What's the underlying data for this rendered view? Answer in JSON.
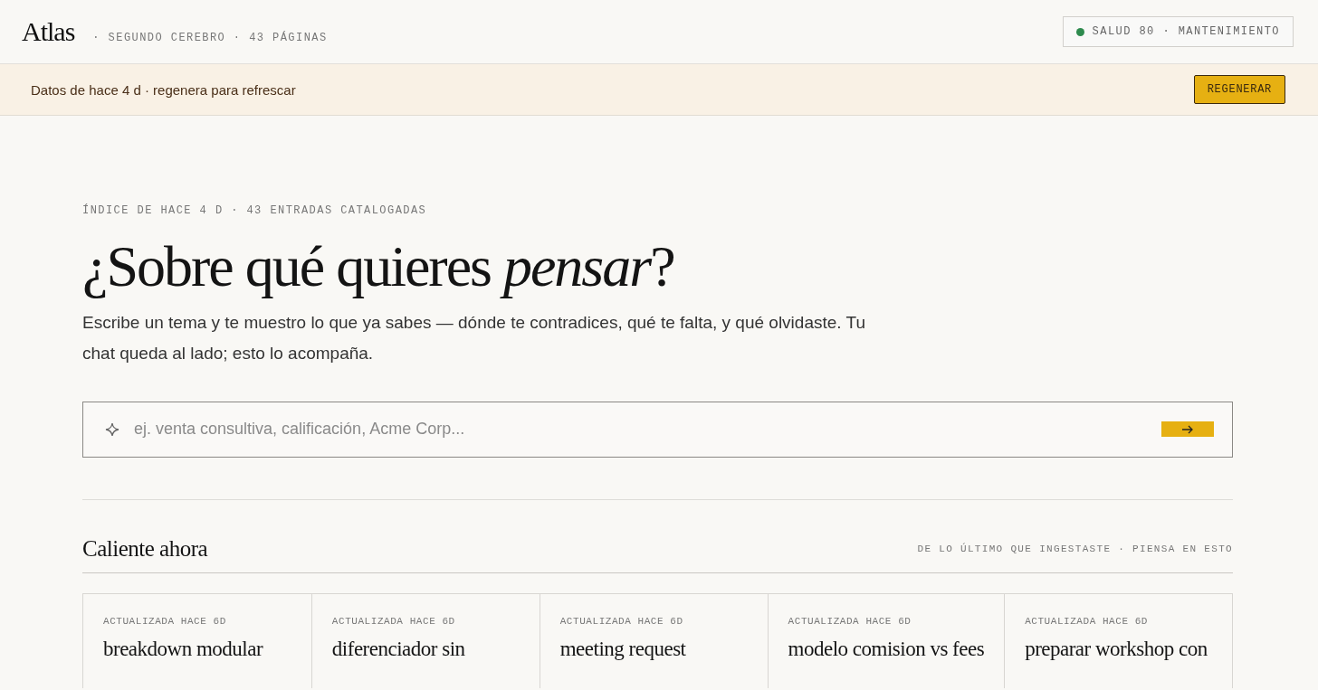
{
  "header": {
    "logo": "Atlas",
    "subtitle": "· SEGUNDO CEREBRO · 43 PÁGINAS",
    "health": {
      "text": "SALUD 80 · MANTENIMIENTO",
      "color": "#2e8b4e"
    }
  },
  "banner": {
    "message": "Datos de hace 4 d · regenera para refrescar",
    "button": "REGENERAR"
  },
  "hero": {
    "eyebrow": "ÍNDICE DE HACE 4 D · 43 ENTRADAS CATALOGADAS",
    "title": "¿Sobre qué quieres *pensar*?",
    "description": "Escribe un tema y te muestro lo que ya sabes — dónde te contradices, qué te falta, y qué olvidaste. Tu chat queda al lado; esto lo acompaña."
  },
  "search": {
    "placeholder": "ej. venta consultiva, calificación, Acme Corp..."
  },
  "section": {
    "title": "Caliente ahora",
    "note": "DE LO ÚLTIMO QUE INGESTASTE · PIENSA EN ESTO"
  },
  "cards": [
    {
      "meta": "ACTUALIZADA HACE 6D",
      "title": "breakdown modular"
    },
    {
      "meta": "ACTUALIZADA HACE 6D",
      "title": "diferenciador sin"
    },
    {
      "meta": "ACTUALIZADA HACE 6D",
      "title": "meeting request"
    },
    {
      "meta": "ACTUALIZADA HACE 6D",
      "title": "modelo comision vs fees"
    },
    {
      "meta": "ACTUALIZADA HACE 6D",
      "title": "preparar workshop con"
    }
  ]
}
